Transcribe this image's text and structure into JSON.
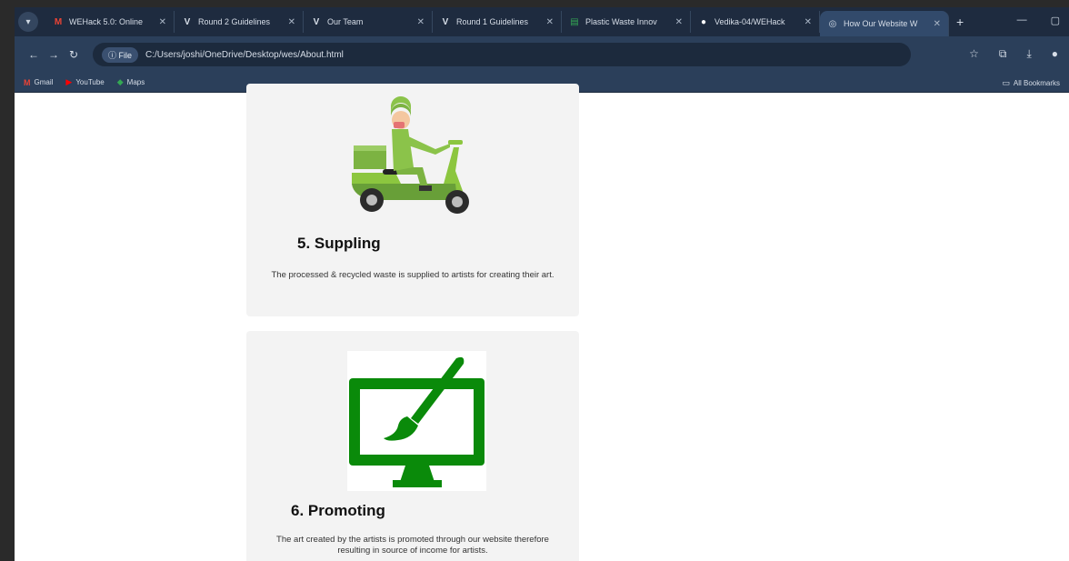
{
  "browser": {
    "tabs": [
      {
        "label": "WEHack 5.0: Online",
        "icon": "gmail-icon",
        "glyph": "M",
        "color": "#ea4335"
      },
      {
        "label": "Round 2 Guidelines",
        "icon": "v-logo-icon",
        "glyph": "V",
        "color": "#d7dee8"
      },
      {
        "label": "Our Team",
        "icon": "v-logo-icon",
        "glyph": "V",
        "color": "#d7dee8"
      },
      {
        "label": "Round 1 Guidelines",
        "icon": "v-logo-icon",
        "glyph": "V",
        "color": "#d7dee8"
      },
      {
        "label": "Plastic Waste Innov",
        "icon": "sheets-icon",
        "glyph": "▤",
        "color": "#34a853"
      },
      {
        "label": "Vedika-04/WEHack",
        "icon": "github-icon",
        "glyph": "●",
        "color": "#ffffff"
      },
      {
        "label": "How Our Website W",
        "icon": "globe-icon",
        "glyph": "◎",
        "color": "#d7dee8"
      }
    ],
    "address": {
      "chip": "ⓘ File",
      "url": "C:/Users/joshi/OneDrive/Desktop/wes/About.html"
    },
    "bookmarks": [
      {
        "label": "Gmail",
        "icon": "gmail-icon",
        "glyph": "M",
        "color": "#ea4335"
      },
      {
        "label": "YouTube",
        "icon": "youtube-icon",
        "glyph": "▶",
        "color": "#ff0000"
      },
      {
        "label": "Maps",
        "icon": "maps-icon",
        "glyph": "◆",
        "color": "#34a853"
      }
    ],
    "all_bookmarks": "All Bookmarks"
  },
  "cards": [
    {
      "title": "5. Suppling",
      "text": "The processed & recycled waste is supplied to artists for creating their art.",
      "image_icon": "delivery-scooter-icon"
    },
    {
      "title": "6. Promoting",
      "text": "The art created by the artists is promoted through our website therefore resulting in source of income for artists.",
      "image_icon": "monitor-paintbrush-icon"
    }
  ],
  "colors": {
    "brand_green": "#0a8a0a",
    "scooter_green": "#8cc63f",
    "card_bg": "#f3f3f3",
    "browser_bg": "#1e2b3f"
  }
}
